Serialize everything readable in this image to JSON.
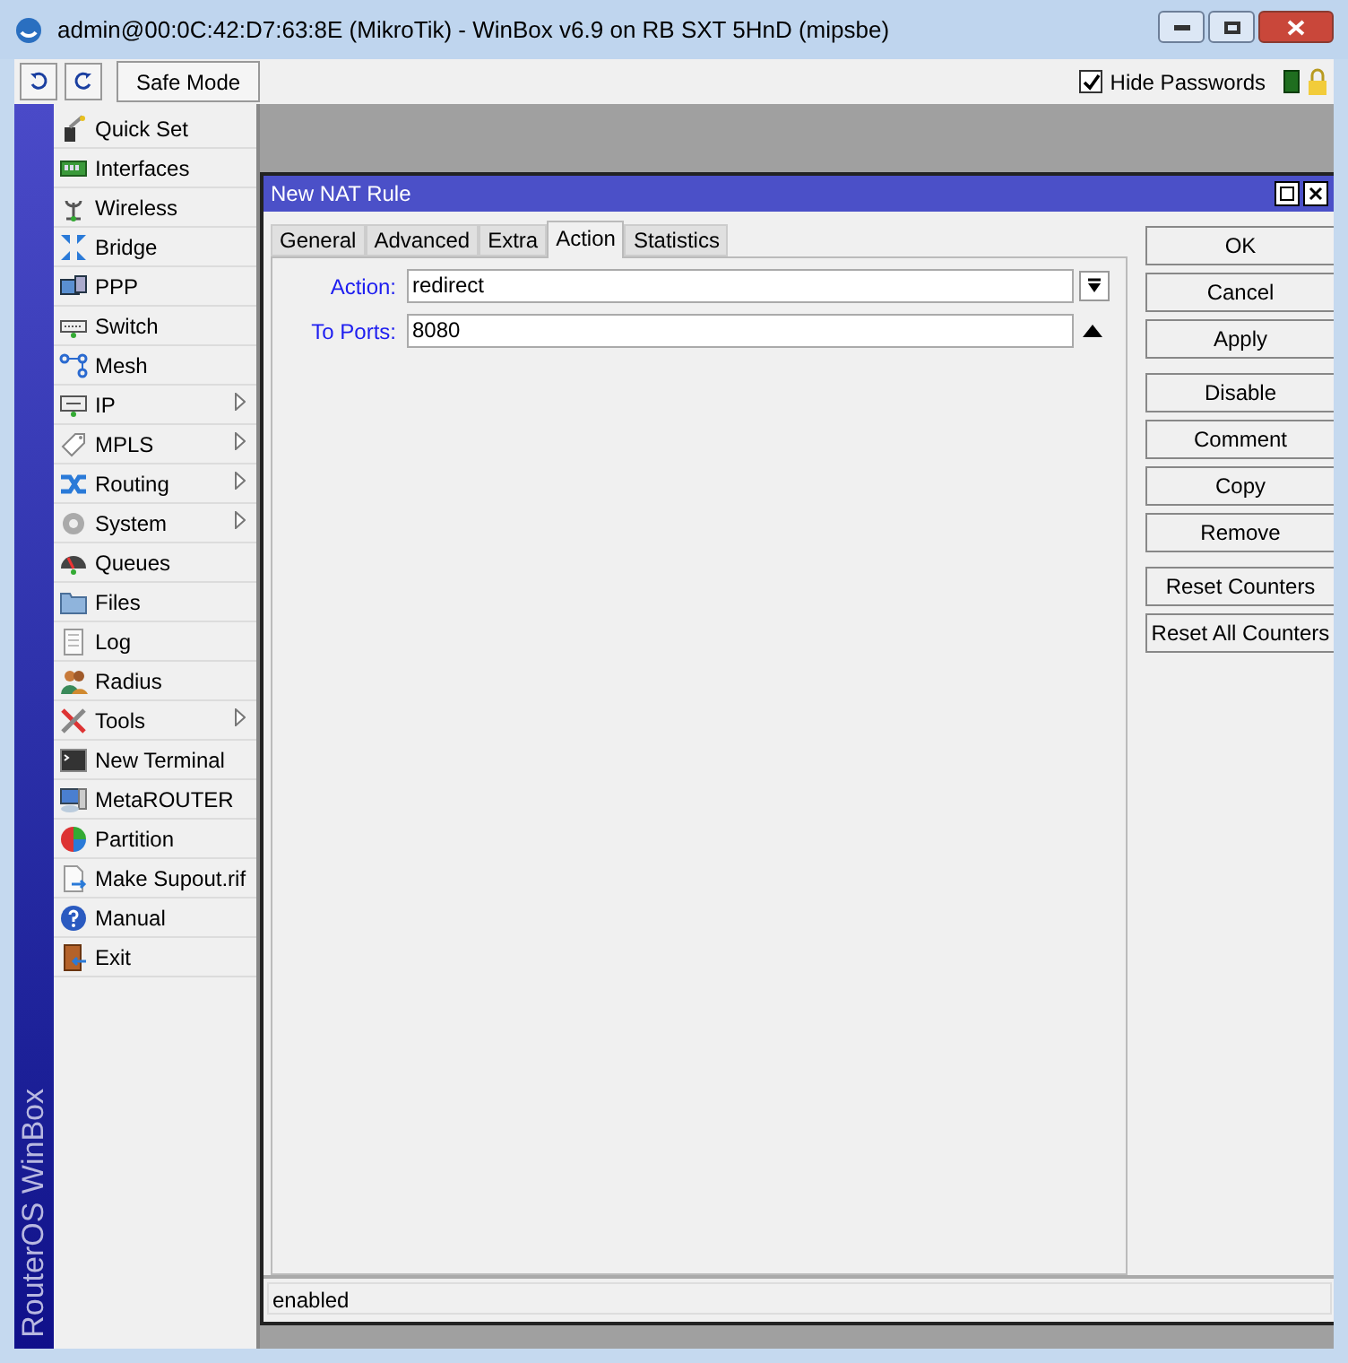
{
  "window": {
    "title": "admin@00:0C:42:D7:63:8E (MikroTik) - WinBox v6.9 on RB SXT 5HnD (mipsbe)"
  },
  "toolbar": {
    "safe_mode": "Safe Mode",
    "hide_passwords": {
      "label": "Hide Passwords",
      "checked": true
    }
  },
  "sidebar": {
    "brand": "RouterOS WinBox",
    "items": [
      {
        "label": "Quick Set",
        "submenu": false
      },
      {
        "label": "Interfaces",
        "submenu": false
      },
      {
        "label": "Wireless",
        "submenu": false
      },
      {
        "label": "Bridge",
        "submenu": false
      },
      {
        "label": "PPP",
        "submenu": false
      },
      {
        "label": "Switch",
        "submenu": false
      },
      {
        "label": "Mesh",
        "submenu": false
      },
      {
        "label": "IP",
        "submenu": true
      },
      {
        "label": "MPLS",
        "submenu": true
      },
      {
        "label": "Routing",
        "submenu": true
      },
      {
        "label": "System",
        "submenu": true
      },
      {
        "label": "Queues",
        "submenu": false
      },
      {
        "label": "Files",
        "submenu": false
      },
      {
        "label": "Log",
        "submenu": false
      },
      {
        "label": "Radius",
        "submenu": false
      },
      {
        "label": "Tools",
        "submenu": true
      },
      {
        "label": "New Terminal",
        "submenu": false
      },
      {
        "label": "MetaROUTER",
        "submenu": false
      },
      {
        "label": "Partition",
        "submenu": false
      },
      {
        "label": "Make Supout.rif",
        "submenu": false
      },
      {
        "label": "Manual",
        "submenu": false
      },
      {
        "label": "Exit",
        "submenu": false
      }
    ]
  },
  "dialog": {
    "title": "New NAT Rule",
    "tabs": [
      {
        "label": "General",
        "selected": false
      },
      {
        "label": "Advanced",
        "selected": false
      },
      {
        "label": "Extra",
        "selected": false
      },
      {
        "label": "Action",
        "selected": true
      },
      {
        "label": "Statistics",
        "selected": false
      }
    ],
    "fields": [
      {
        "label": "Action:",
        "value": "redirect",
        "kind": "dropdown"
      },
      {
        "label": "To Ports:",
        "value": "8080",
        "kind": "collapse"
      }
    ],
    "button_groups": [
      [
        "OK",
        "Cancel",
        "Apply"
      ],
      [
        "Disable",
        "Comment",
        "Copy",
        "Remove"
      ],
      [
        "Reset Counters",
        "Reset All Counters"
      ]
    ],
    "status": "enabled"
  }
}
